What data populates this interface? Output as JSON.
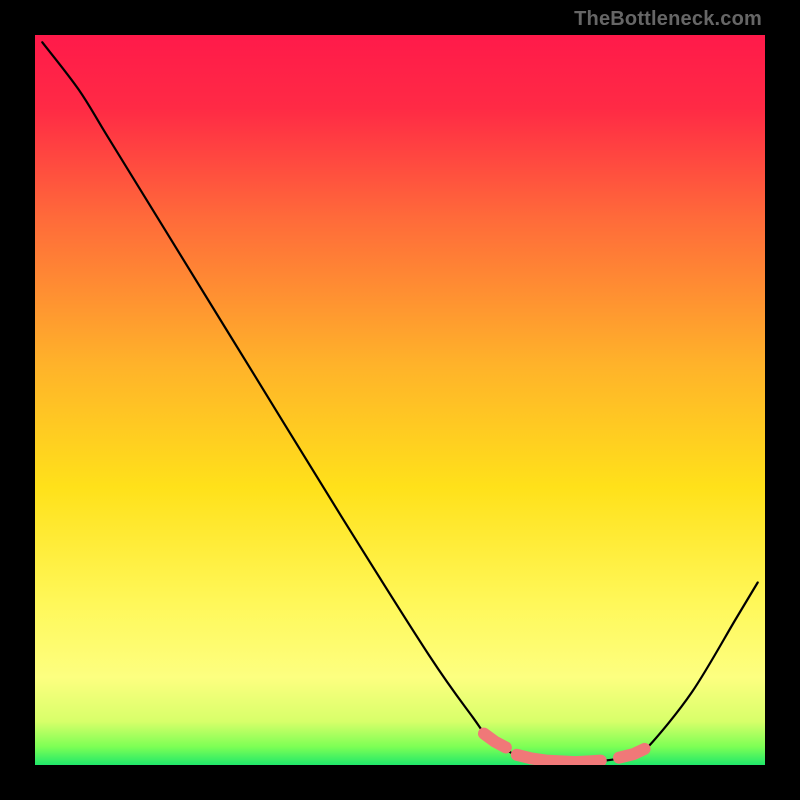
{
  "attribution": "TheBottleneck.com",
  "colors": {
    "frame": "#000000",
    "gradient_stops": [
      {
        "offset": 0.0,
        "color": "#ff1a4a"
      },
      {
        "offset": 0.1,
        "color": "#ff2a45"
      },
      {
        "offset": 0.25,
        "color": "#ff6a3a"
      },
      {
        "offset": 0.45,
        "color": "#ffb22a"
      },
      {
        "offset": 0.62,
        "color": "#ffe11a"
      },
      {
        "offset": 0.78,
        "color": "#fff85a"
      },
      {
        "offset": 0.88,
        "color": "#fdff80"
      },
      {
        "offset": 0.94,
        "color": "#d8ff6a"
      },
      {
        "offset": 0.975,
        "color": "#7dff55"
      },
      {
        "offset": 1.0,
        "color": "#20e86a"
      }
    ],
    "curve": "#000000",
    "marker_fill": "#f07878",
    "marker_stroke": "#c04848"
  },
  "chart_data": {
    "type": "line",
    "title": "",
    "xlabel": "",
    "ylabel": "",
    "xrange": [
      0,
      100
    ],
    "yrange": [
      0,
      100
    ],
    "description": "Bottleneck percentage curve descending from high mismatch at left to optimal match near x≈75 then rising again; highlighted optimal band near the minimum.",
    "curve": [
      {
        "x": 1.0,
        "y": 99.0
      },
      {
        "x": 6.0,
        "y": 92.5
      },
      {
        "x": 10.0,
        "y": 86.0
      },
      {
        "x": 18.0,
        "y": 73.0
      },
      {
        "x": 30.0,
        "y": 53.5
      },
      {
        "x": 42.0,
        "y": 34.0
      },
      {
        "x": 54.0,
        "y": 15.0
      },
      {
        "x": 60.0,
        "y": 6.5
      },
      {
        "x": 62.0,
        "y": 4.0
      },
      {
        "x": 66.0,
        "y": 1.3
      },
      {
        "x": 70.0,
        "y": 0.6
      },
      {
        "x": 74.0,
        "y": 0.4
      },
      {
        "x": 78.0,
        "y": 0.6
      },
      {
        "x": 82.0,
        "y": 1.3
      },
      {
        "x": 84.0,
        "y": 2.5
      },
      {
        "x": 90.0,
        "y": 10.0
      },
      {
        "x": 96.0,
        "y": 20.0
      },
      {
        "x": 99.0,
        "y": 25.0
      }
    ],
    "marker_segments": [
      [
        {
          "x": 61.5,
          "y": 4.3
        },
        {
          "x": 63.0,
          "y": 3.2
        },
        {
          "x": 64.5,
          "y": 2.4
        }
      ],
      [
        {
          "x": 66.0,
          "y": 1.4
        },
        {
          "x": 68.0,
          "y": 0.9
        },
        {
          "x": 70.0,
          "y": 0.6
        },
        {
          "x": 72.0,
          "y": 0.5
        },
        {
          "x": 74.0,
          "y": 0.4
        },
        {
          "x": 76.0,
          "y": 0.5
        },
        {
          "x": 77.5,
          "y": 0.6
        }
      ],
      [
        {
          "x": 80.0,
          "y": 1.0
        },
        {
          "x": 82.0,
          "y": 1.5
        },
        {
          "x": 83.5,
          "y": 2.2
        }
      ]
    ]
  }
}
